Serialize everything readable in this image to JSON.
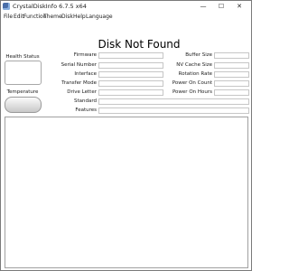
{
  "window": {
    "title": "CrystalDiskInfo 6.7.5 x64",
    "minimize_glyph": "—",
    "maximize_glyph": "☐",
    "close_glyph": "✕"
  },
  "menu": {
    "items": [
      "File",
      "Edit",
      "Function",
      "Theme",
      "Disk",
      "Help",
      "Language"
    ]
  },
  "disk": {
    "title": "Disk Not Found"
  },
  "status": {
    "health_label": "Health Status",
    "temperature_label": "Temperature"
  },
  "fields": {
    "left": [
      "Firmware",
      "Serial Number",
      "Interface",
      "Transfer Mode",
      "Drive Letter",
      "Standard",
      "Features"
    ],
    "right": [
      "Buffer Size",
      "NV Cache Size",
      "Rotation Rate",
      "Power On Count",
      "Power On Hours"
    ]
  },
  "icons": {
    "app": "crystaldiskinfo-app-icon"
  }
}
